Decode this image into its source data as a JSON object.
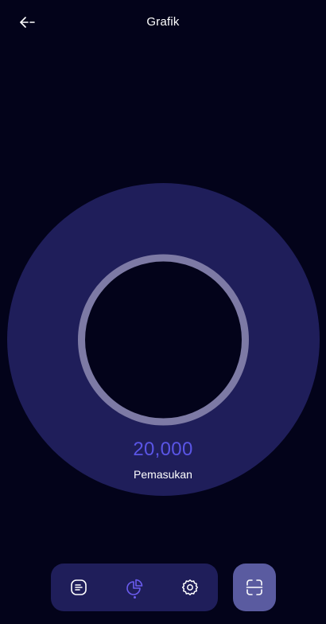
{
  "header": {
    "title": "Grafik",
    "back_icon": "arrow-left-icon"
  },
  "chart_data": {
    "type": "pie",
    "categories": [
      "Pemasukan"
    ],
    "values": [
      20000
    ],
    "colors": [
      "#1f1e5a"
    ]
  },
  "summary": {
    "value": "20,000",
    "label": "Pemasukan",
    "value_color": "#5a55e6"
  },
  "bottom_nav": {
    "items": [
      {
        "icon": "list-document-icon",
        "active": false
      },
      {
        "icon": "pie-chart-icon",
        "active": true
      },
      {
        "icon": "gear-icon",
        "active": false
      }
    ],
    "scan_icon": "scan-icon"
  },
  "colors": {
    "background": "#03031a",
    "chart_fill": "#1f1e5a",
    "ring": "#7d7aa5",
    "nav_bg": "#1f1e5a",
    "scan_bg": "#5a5ba0",
    "accent": "#6b5cf0"
  }
}
